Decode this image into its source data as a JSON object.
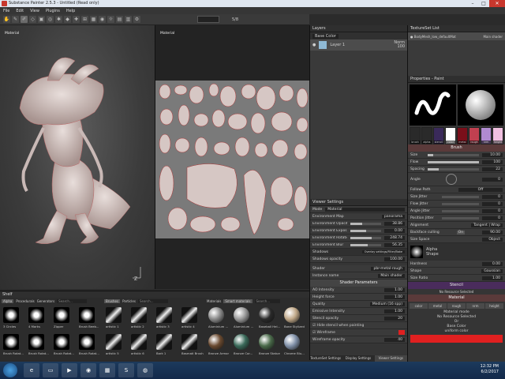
{
  "window": {
    "title": "Substance Painter 2.5.3 - Untitled (Read only)"
  },
  "menu": [
    "File",
    "Edit",
    "View",
    "Plugins",
    "Help"
  ],
  "toolbar": {
    "counter": "5/8"
  },
  "viewport": {
    "left_label": "Material",
    "right_label": "Material"
  },
  "layers": {
    "title": "Layers",
    "blend_mode": "Base Color",
    "items": [
      {
        "name": "Layer 1",
        "mode": "Norm",
        "opacity": "100"
      }
    ]
  },
  "viewer_settings": {
    "title": "Viewer Settings",
    "mode_label": "Mode",
    "mode_value": "Material",
    "env_map_label": "Environment Map",
    "env_map_value": "panorama",
    "sliders": [
      {
        "label": "Environment Opacity",
        "value": "38.86",
        "fill": 0.39
      },
      {
        "label": "Environment Exposure (EV)",
        "value": "0.00",
        "fill": 0.5
      },
      {
        "label": "Environment Rotation",
        "value": "248.74",
        "fill": 0.69
      },
      {
        "label": "Environment Blur",
        "value": "56.35",
        "fill": 0.56
      }
    ],
    "shadows_label": "Shadows",
    "shadows_value": "Overlay settings/Filter/Bake",
    "shadows_opacity_label": "Shadows opacity",
    "shadows_opacity_value": "100.00",
    "shader_label": "Shader",
    "shader_value": "pbr-metal-rough",
    "instance_label": "Instance name",
    "instance_value": "Main shader",
    "shader_params": "Shader Parameters",
    "params": [
      {
        "label": "AO Intensity",
        "value": "1.00"
      },
      {
        "label": "Height force",
        "value": "1.00"
      },
      {
        "label": "Quality",
        "value": "Medium (16 spp)"
      },
      {
        "label": "Emissive Intensity",
        "value": "1.00"
      }
    ],
    "stencil_label": "Stencil opacity",
    "stencil_value": "20",
    "hide_stencil": "Hide stencil when painting",
    "wireframe": "Wireframe",
    "wire_opacity_label": "Wireframe opacity",
    "wire_opacity_value": "40"
  },
  "bottom_tabs": [
    "TextureSet Settings",
    "Display Settings",
    "Viewer Settings"
  ],
  "textureset": {
    "title": "TextureSet List",
    "item": "BodyMesh_low_defaultMat",
    "shader": "Main shader"
  },
  "properties": {
    "title": "Properties - Paint",
    "swatches": [
      "brush",
      "alpha",
      "stencil",
      "color",
      "metal",
      "rough",
      "nrm",
      "height"
    ],
    "brush_section": "Brush",
    "brush_rows": [
      {
        "label": "Size",
        "value": "10.00",
        "fill": 0.1
      },
      {
        "label": "Flow",
        "value": "100",
        "fill": 1.0
      },
      {
        "label": "Spacing",
        "value": "22",
        "fill": 0.22
      }
    ],
    "angle_label": "Angle",
    "angle_value": "0",
    "follow_path": "Follow Path",
    "follow_value": "Off",
    "jitters": [
      {
        "label": "Size Jitter",
        "value": "0"
      },
      {
        "label": "Flow Jitter",
        "value": "0"
      },
      {
        "label": "Angle Jitter",
        "value": "0"
      },
      {
        "label": "Position Jitter",
        "value": "0"
      }
    ],
    "alignment_label": "Alignment",
    "alignment_value": "Tangent | Wrap",
    "backface_label": "Backface culling",
    "backface_on": "On",
    "backface_value": "90.00",
    "size_space_label": "Size Space",
    "size_space_value": "Object",
    "alpha_label": "Alpha",
    "alpha_sub": "Shape",
    "hardness_label": "Hardness",
    "hardness_value": "0.00",
    "shape_label": "Shape",
    "shape_value": "Gaussian",
    "ratio_label": "Size Ratio",
    "ratio_value": "1.00",
    "stencil_section": "Stencil",
    "stencil_none": "No Resource Selected",
    "material_section": "Material",
    "channels": [
      "color",
      "metal",
      "rough",
      "nrm",
      "height"
    ],
    "material_mode": "Material mode",
    "material_none": "No Resource Selected",
    "or": "Or",
    "base_color": "Base Color",
    "base_color_sub": "uniform color"
  },
  "shelf": {
    "title": "Shelf",
    "tabs_left": [
      "Alpha",
      "Procedurals",
      "Generators"
    ],
    "search": "Search...",
    "alpha_items": [
      "3 Circles",
      "4 Marks",
      "Zipper",
      "Brush Beeb...",
      "Brush Rotat...",
      "Brush Rotat...",
      "Brush Rotat...",
      "Brush Rotat..."
    ],
    "brushes_tab": "Brushes",
    "particles_tab": "Particles",
    "brush_items": [
      "artistic 1",
      "artistic 2",
      "artistic 3",
      "artistic 4",
      "artistic 5",
      "artistic 6",
      "Bark 1",
      "Basmati Brush"
    ],
    "materials_tab": "Materials",
    "smart_tab": "Smart materials",
    "material_items": [
      "Aluminium ...",
      "Aluminium ...",
      "Baseball Hel...",
      "Bone Stylized",
      "Bronze Armor",
      "Bronze Cor...",
      "Bronze Statue",
      "Chrome Blu..."
    ]
  },
  "taskbar": {
    "time": "12:32 PM",
    "date": "6/2/2017"
  },
  "colors": {
    "accent_red": "#5a3a3a",
    "accent_purple": "#4a2c5c",
    "base_color": "#e02020"
  }
}
